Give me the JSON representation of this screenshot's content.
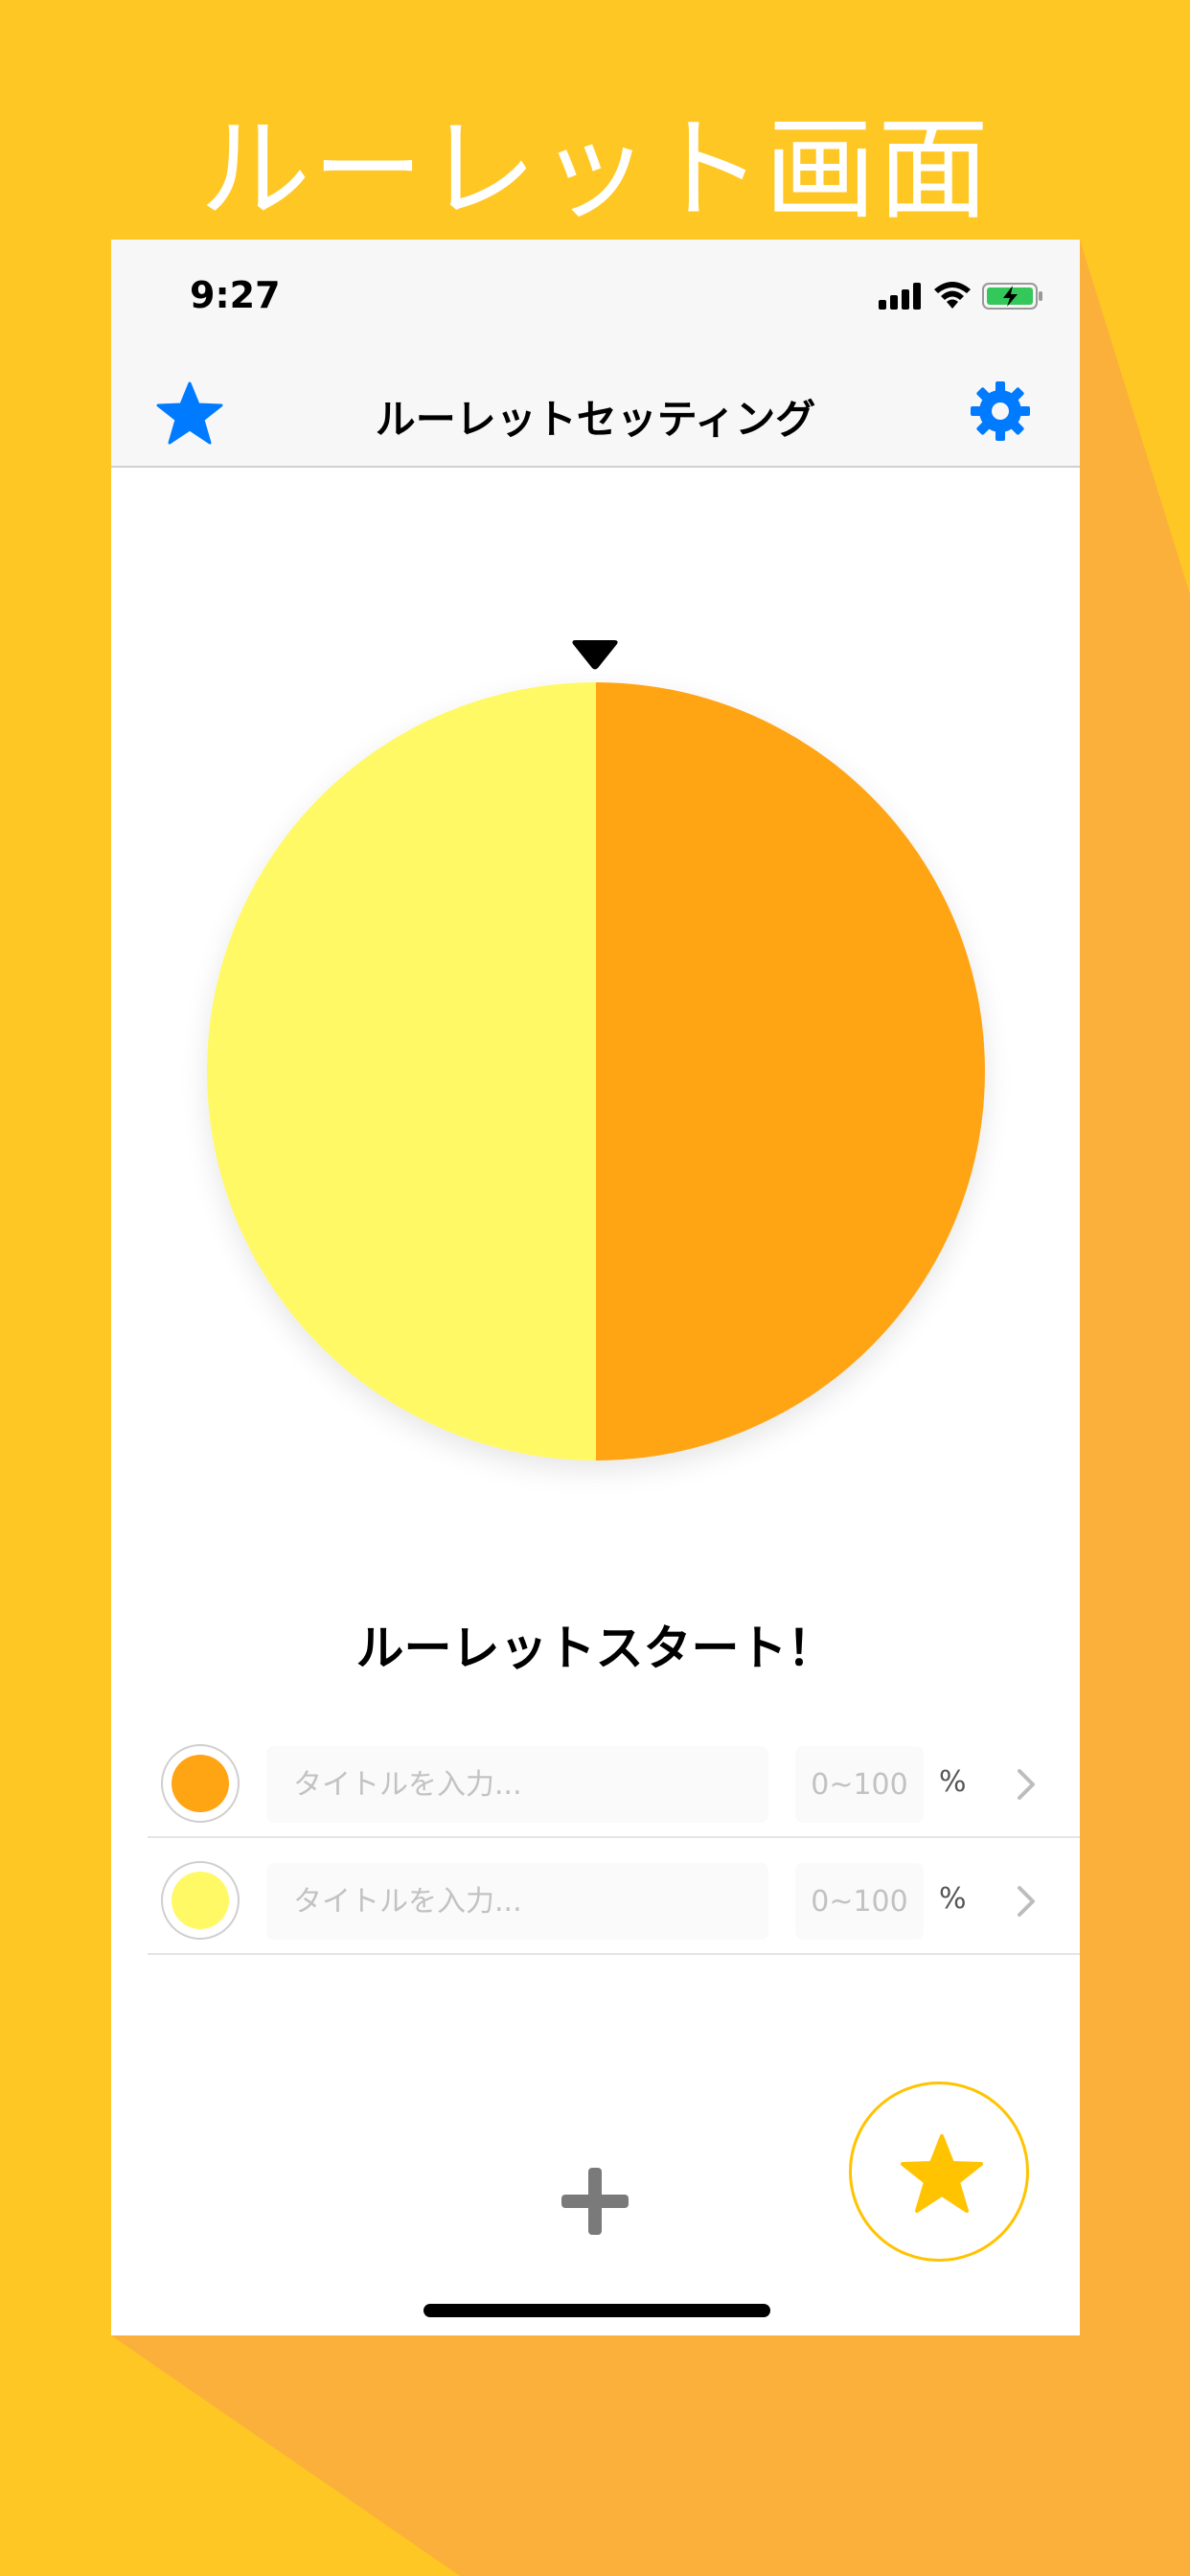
{
  "promo": {
    "title": "ルーレット画面"
  },
  "colors": {
    "background_yellow": "#FFC724",
    "background_orange": "#FBB03B",
    "segment_orange": "#FFA514",
    "segment_yellow": "#FFF966",
    "accent_blue": "#007AFF",
    "fav_star": "#FFC300"
  },
  "status_bar": {
    "time": "9:27",
    "icons": [
      "signal-icon",
      "wifi-icon",
      "battery-charging-icon"
    ]
  },
  "nav": {
    "title": "ルーレットセッティング",
    "left_icon": "star-icon",
    "right_icon": "gear-icon"
  },
  "roulette": {
    "segments": [
      {
        "color": "#FFA514",
        "share": 0.5
      },
      {
        "color": "#FFF966",
        "share": 0.5
      }
    ]
  },
  "start_label": "ルーレットスタート！",
  "items": [
    {
      "color": "#FFA514",
      "title_placeholder": "タイトルを入力...",
      "title_value": "",
      "percent_placeholder": "0~100",
      "percent_value": "",
      "unit": "%"
    },
    {
      "color": "#FFF966",
      "title_placeholder": "タイトルを入力...",
      "title_value": "",
      "percent_placeholder": "0~100",
      "percent_value": "",
      "unit": "%"
    }
  ],
  "bottom": {
    "add_icon": "plus-icon",
    "fav_icon": "star-icon"
  }
}
